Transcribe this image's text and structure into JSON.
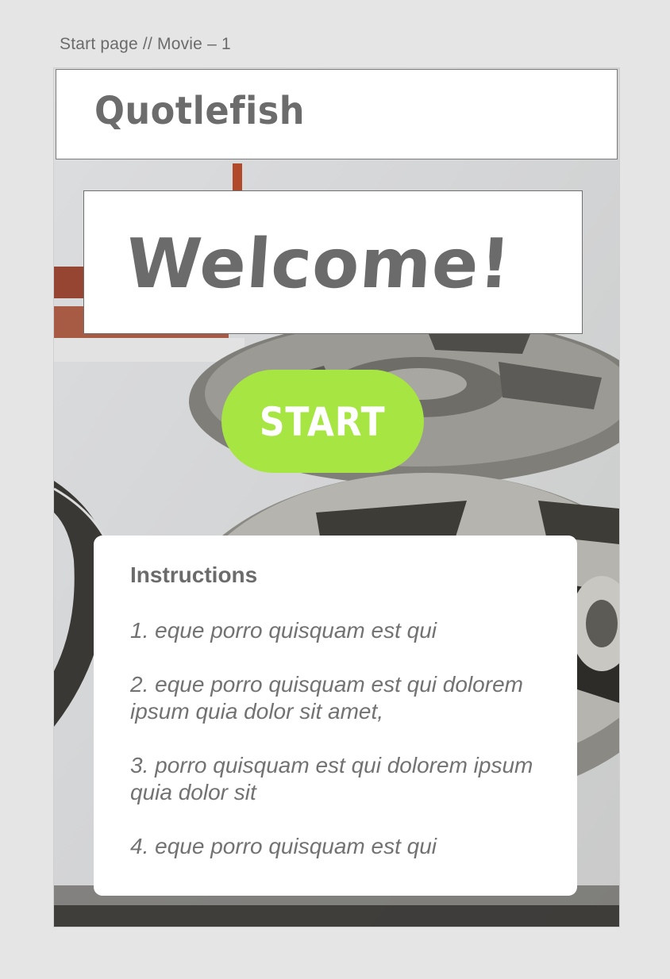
{
  "frame": {
    "label": "Start page // Movie – 1"
  },
  "header": {
    "logo": "Quotlefish"
  },
  "hero": {
    "welcome": "Welcome!",
    "start_label": "START"
  },
  "instructions": {
    "title": "Instructions",
    "items": [
      "1. eque porro quisquam est qui",
      "2. eque porro quisquam est qui dolorem ipsum quia dolor sit amet,",
      "3. porro quisquam est qui dolorem ipsum quia dolor sit",
      "4. eque porro quisquam est qui"
    ]
  },
  "colors": {
    "start_button": "#a6e542",
    "text_gray": "#6b6b6b"
  }
}
